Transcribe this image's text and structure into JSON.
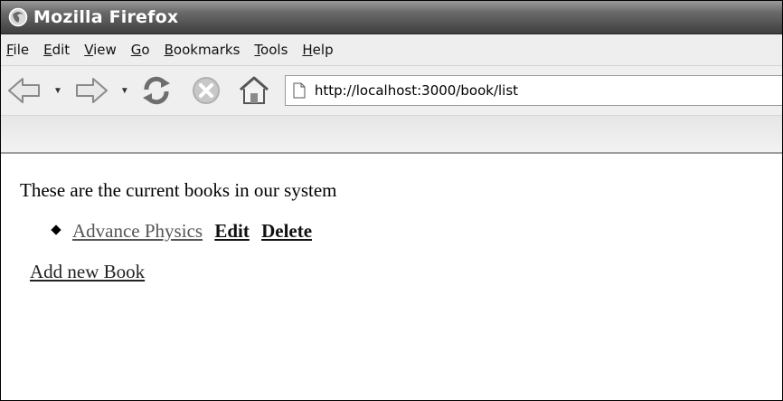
{
  "window": {
    "title": "Mozilla Firefox"
  },
  "menubar": {
    "items": [
      {
        "label": "File",
        "underline": 0
      },
      {
        "label": "Edit",
        "underline": 0
      },
      {
        "label": "View",
        "underline": 0
      },
      {
        "label": "Go",
        "underline": 0
      },
      {
        "label": "Bookmarks",
        "underline": 0
      },
      {
        "label": "Tools",
        "underline": 0
      },
      {
        "label": "Help",
        "underline": 0
      }
    ]
  },
  "toolbar": {
    "icons": [
      "back-icon",
      "forward-icon",
      "reload-icon",
      "stop-icon",
      "home-icon"
    ],
    "address": "http://localhost:3000/book/list"
  },
  "page": {
    "intro": "These are the current books in our system",
    "books": [
      {
        "title": "Advance Physics",
        "edit_label": "Edit",
        "delete_label": "Delete"
      }
    ],
    "add_label": "Add new Book"
  }
}
